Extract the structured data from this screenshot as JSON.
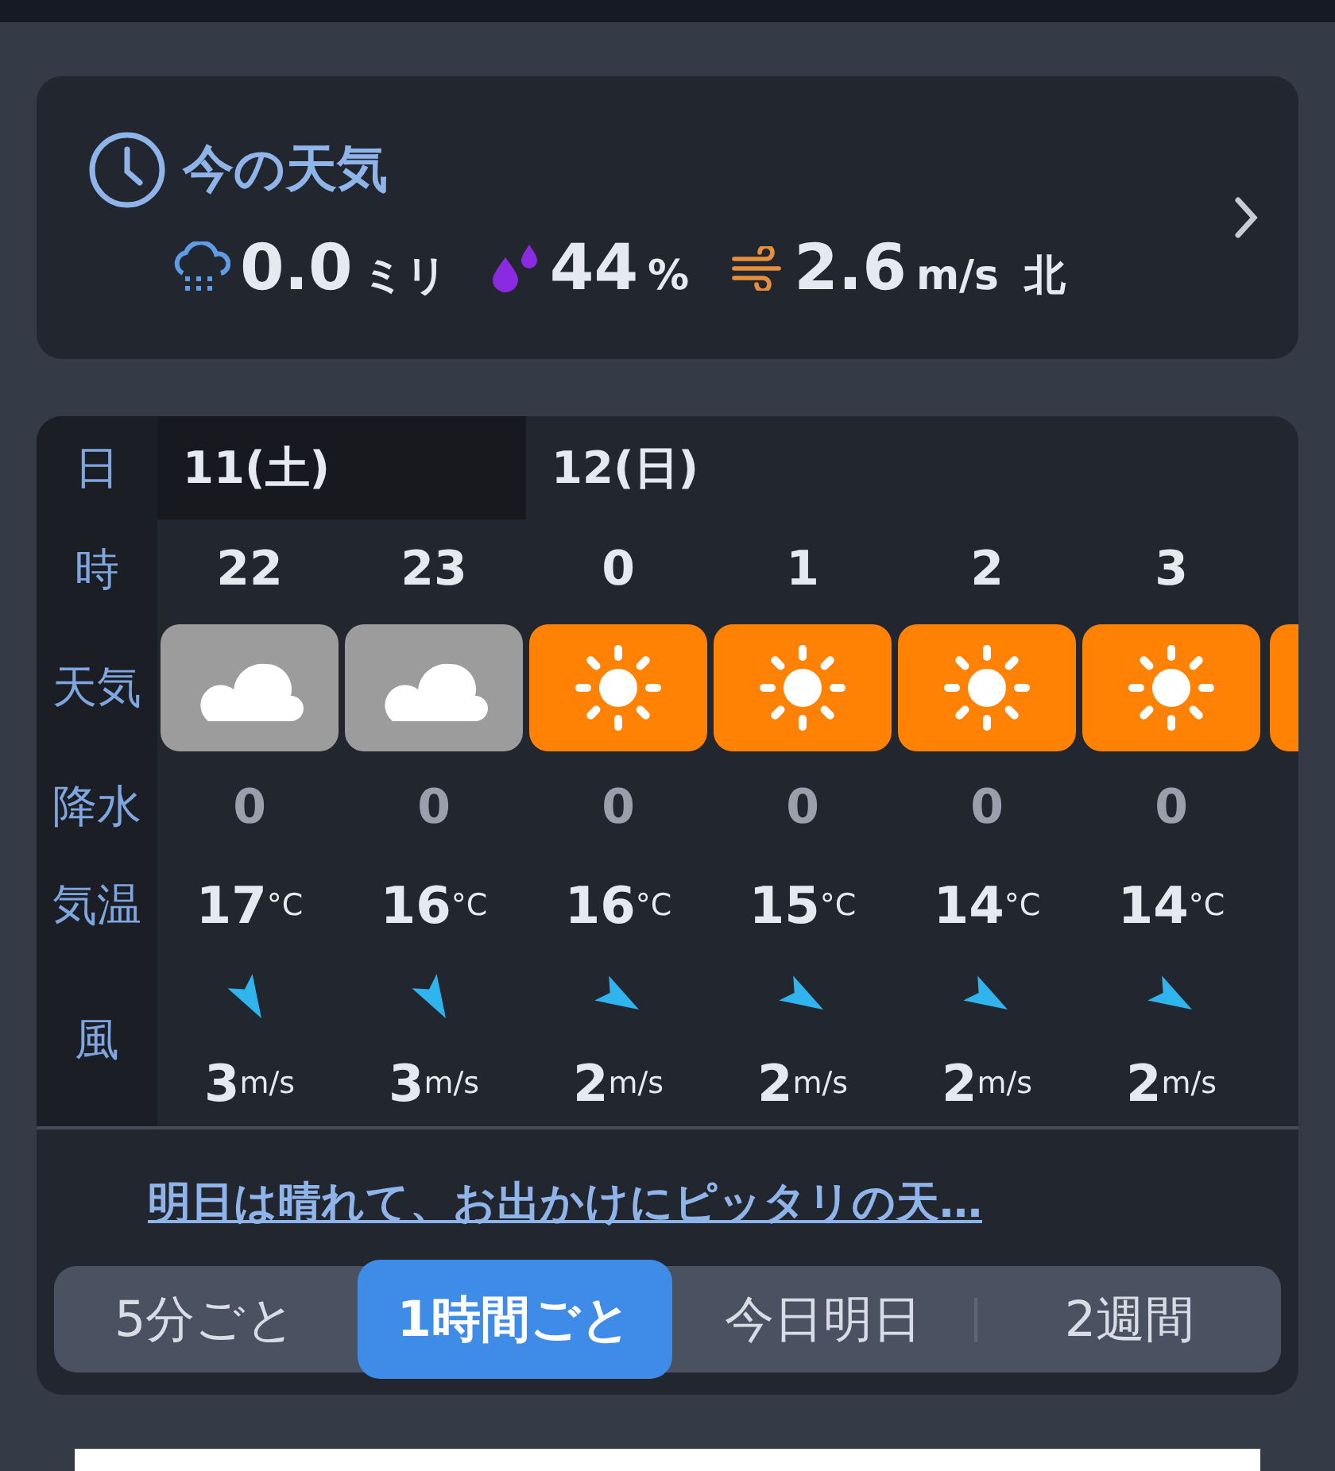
{
  "current": {
    "title": "今の天気",
    "rain": {
      "value": "0.0",
      "unit": "ミリ"
    },
    "humidity": {
      "value": "44",
      "unit": "%"
    },
    "wind": {
      "value": "2.6",
      "unit": "m/s",
      "direction": "北"
    }
  },
  "table": {
    "labels": {
      "date": "日",
      "hour": "時",
      "weather": "天気",
      "precip": "降水",
      "temp": "気温",
      "wind": "風"
    },
    "dates": [
      {
        "label": "11(土)",
        "kind": "short"
      },
      {
        "label": "12(日)",
        "kind": "long"
      }
    ],
    "hours": [
      {
        "hour": "22",
        "kind": "cloudy",
        "precip": "0",
        "temp": "17",
        "temp_unit": "°C",
        "arrow": {
          "kind": "SSE"
        },
        "wind": "3",
        "wind_unit": "m/s"
      },
      {
        "hour": "23",
        "kind": "cloudy",
        "precip": "0",
        "temp": "16",
        "temp_unit": "°C",
        "arrow": {
          "kind": "SSE"
        },
        "wind": "3",
        "wind_unit": "m/s"
      },
      {
        "hour": "0",
        "kind": "sunny",
        "precip": "0",
        "temp": "16",
        "temp_unit": "°C",
        "arrow": {
          "kind": "ESE"
        },
        "wind": "2",
        "wind_unit": "m/s"
      },
      {
        "hour": "1",
        "kind": "sunny",
        "precip": "0",
        "temp": "15",
        "temp_unit": "°C",
        "arrow": {
          "kind": "ESE"
        },
        "wind": "2",
        "wind_unit": "m/s"
      },
      {
        "hour": "2",
        "kind": "sunny",
        "precip": "0",
        "temp": "14",
        "temp_unit": "°C",
        "arrow": {
          "kind": "ESE"
        },
        "wind": "2",
        "wind_unit": "m/s"
      },
      {
        "hour": "3",
        "kind": "sunny",
        "precip": "0",
        "temp": "14",
        "temp_unit": "°C",
        "arrow": {
          "kind": "ESE"
        },
        "wind": "2",
        "wind_unit": "m/s"
      }
    ],
    "next_tile": {
      "kind": "sunny"
    }
  },
  "summary_link": "明日は晴れて、お出かけにピッタリの天…",
  "segments": [
    {
      "label": "5分ごと",
      "selected": false
    },
    {
      "label": "1時間ごと",
      "selected": true
    },
    {
      "label": "今日明日",
      "selected": false
    },
    {
      "label": "2週間",
      "selected": false
    }
  ]
}
